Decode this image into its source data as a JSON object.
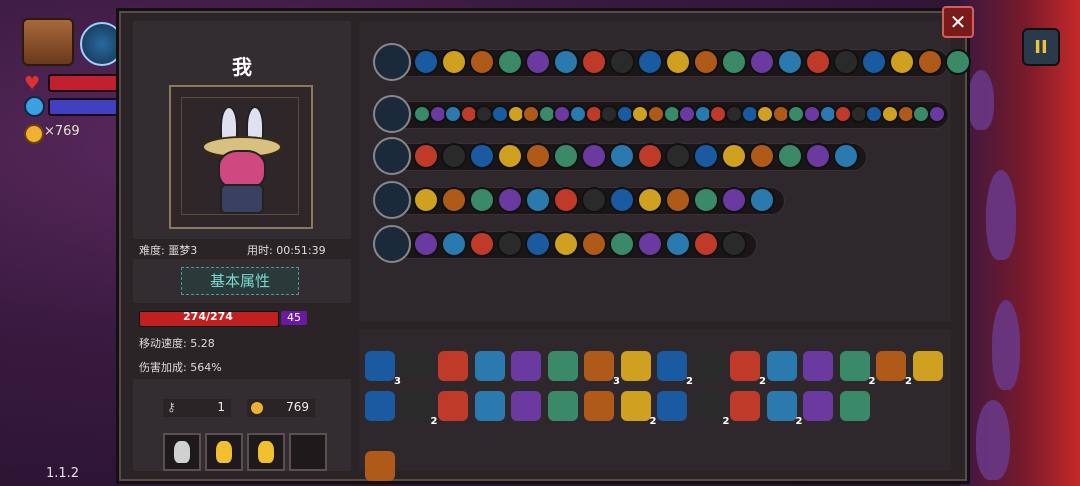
{
  "hud": {
    "coins": "×769",
    "version": "1.1.2",
    "pause_label": "II"
  },
  "dialog": {
    "close_label": "✕",
    "character": {
      "name": "我",
      "difficulty": "难度: 噩梦3",
      "time": "用时: 00:51:39",
      "attr_title": "基本属性",
      "hp": "274/274",
      "shield": "45",
      "move_speed": "移动速度: 5.28",
      "damage_bonus": "伤害加成: 564%",
      "keys": "1",
      "coins": "769"
    },
    "weapon_rows": [
      {
        "name": "inventory-chest-row",
        "count": 20
      },
      {
        "name": "wand-row-1",
        "count": 34
      },
      {
        "name": "wand-row-2",
        "count": 16
      },
      {
        "name": "wand-row-3",
        "count": 13
      },
      {
        "name": "wand-row-4",
        "count": 12
      }
    ],
    "inventory": {
      "counts": [
        "3",
        "3",
        "2",
        "2",
        "2",
        "2",
        "2",
        "2",
        "2",
        "2"
      ]
    }
  }
}
